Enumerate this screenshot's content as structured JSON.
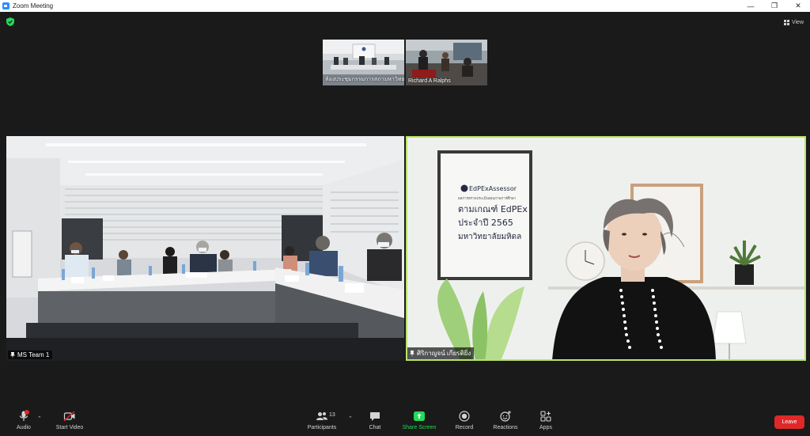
{
  "window": {
    "title": "Zoom Meeting",
    "controls": {
      "minimize": "—",
      "restore": "❐",
      "close": "✕"
    }
  },
  "header": {
    "view_label": "View"
  },
  "thumbnails": [
    {
      "name": "ห้องประชุมกรรมการสภามหาวิทยาลัย E"
    },
    {
      "name": "Richard A Ralphs"
    }
  ],
  "tiles": [
    {
      "name": "MS Team 1"
    },
    {
      "name": "ศิริกาญจน์ เกียรติยิ่ง",
      "slide": {
        "brand": "EdPExAssessor",
        "line1": "ผลการตรวจประเมินคุณภาพการศึกษา",
        "line2": "ตามเกณฑ์ EdPEx",
        "line3": "ประจำปี 2565",
        "line4": "มหาวิทยาลัยมหิดล"
      }
    }
  ],
  "toolbar": {
    "audio": "Audio",
    "start_video": "Start Video",
    "participants": "Participants",
    "participants_count": "13",
    "chat": "Chat",
    "share_screen": "Share Screen",
    "record": "Record",
    "reactions": "Reactions",
    "apps": "Apps",
    "leave": "Leave",
    "audio_badge": "1"
  },
  "colors": {
    "accent_green": "#23d959",
    "leave_red": "#e02828",
    "active_speaker": "#b7e36b",
    "security_green": "#23d959"
  }
}
